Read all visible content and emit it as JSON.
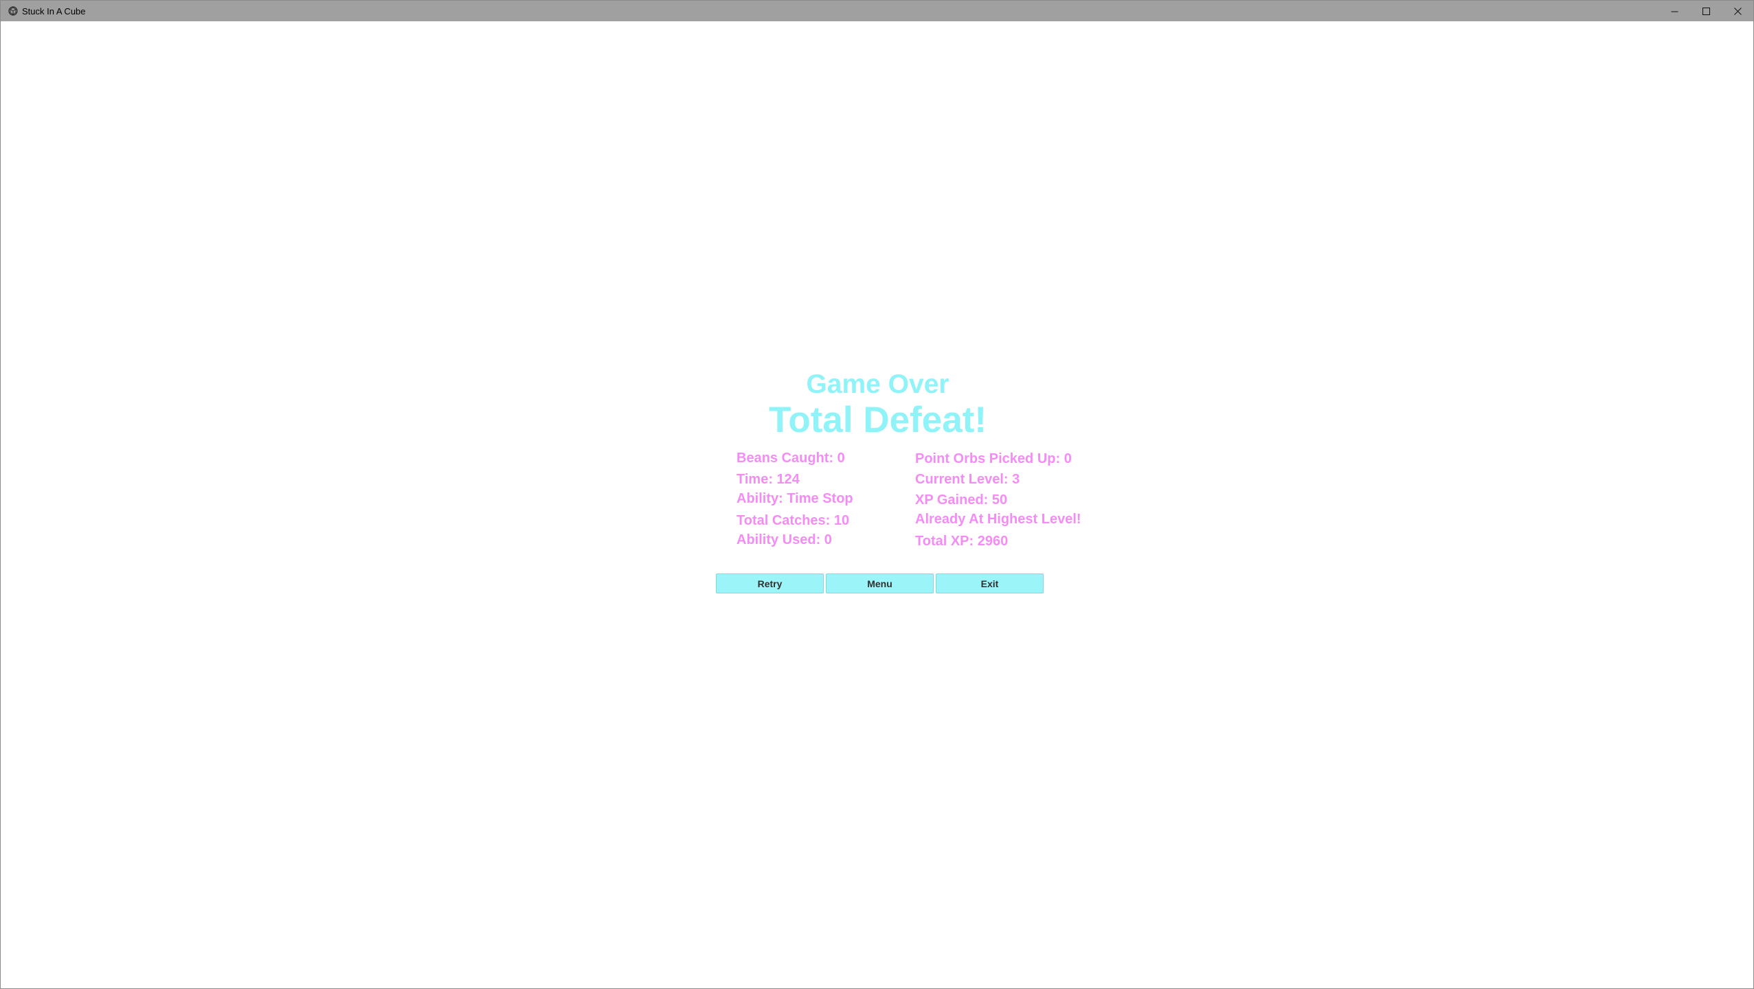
{
  "window": {
    "title": "Stuck In A Cube",
    "icon": "unity-cube-icon",
    "controls": [
      "minimize-icon",
      "maximize-icon",
      "close-icon"
    ]
  },
  "game_over": {
    "heading": "Game Over",
    "subheading": "Total Defeat!"
  },
  "stats": {
    "left": [
      "Beans Caught: 0",
      "Time: 124",
      "Ability: Time Stop",
      "Total Catches: 10",
      "Ability Used: 0"
    ],
    "right": [
      "Point Orbs Picked Up: 0",
      "Current Level: 3",
      "XP Gained: 50",
      "Already At Highest Level!",
      "Total XP: 2960"
    ]
  },
  "buttons": {
    "retry": "Retry",
    "menu": "Menu",
    "exit": "Exit"
  },
  "colors": {
    "titlebar": "#a0a0a0",
    "heading": "#8ff3f8",
    "stats": "#f48cf5",
    "button": "#9bf5f8",
    "button_text": "#303030"
  }
}
